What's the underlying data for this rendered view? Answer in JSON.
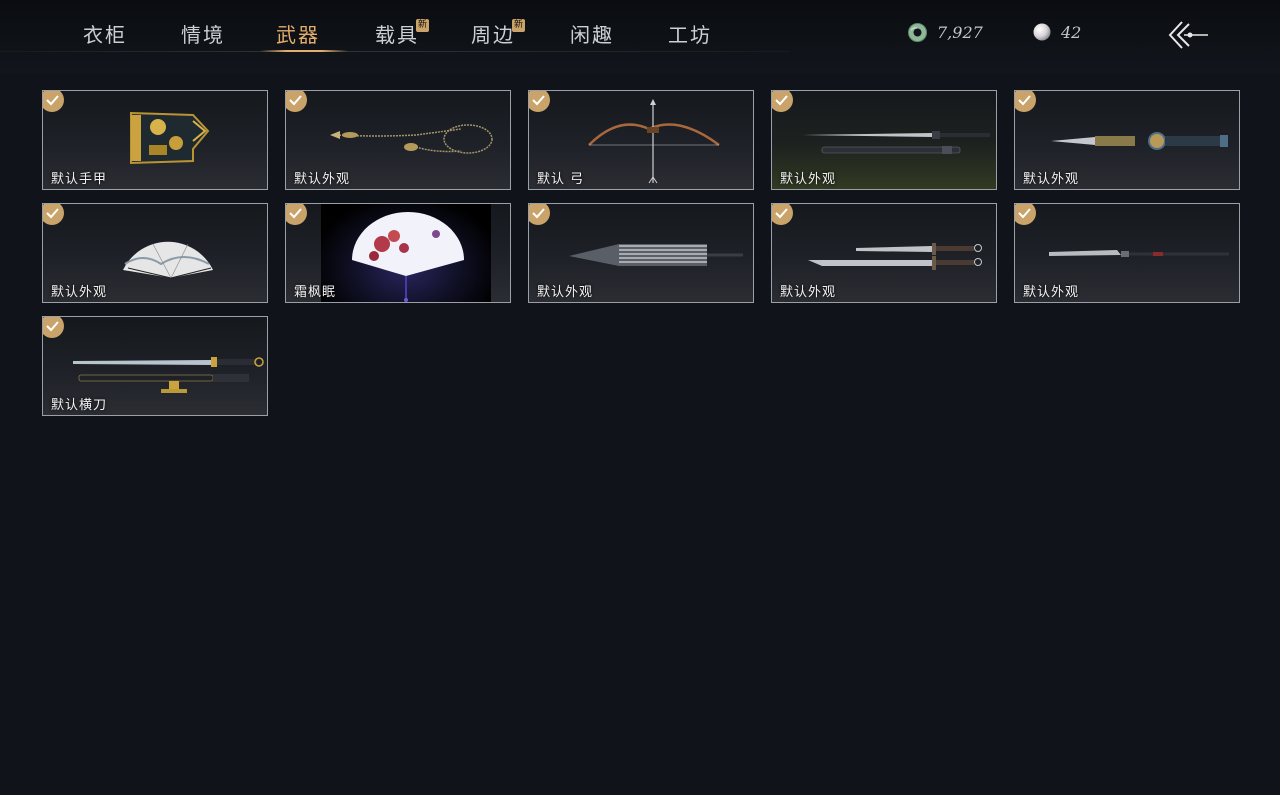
{
  "nav": {
    "tabs": [
      {
        "label": "衣柜",
        "active": false,
        "badge": ""
      },
      {
        "label": "情境",
        "active": false,
        "badge": ""
      },
      {
        "label": "武器",
        "active": true,
        "badge": ""
      },
      {
        "label": "载具",
        "active": false,
        "badge": "新"
      },
      {
        "label": "周边",
        "active": false,
        "badge": "新"
      },
      {
        "label": "闲趣",
        "active": false,
        "badge": ""
      },
      {
        "label": "工坊",
        "active": false,
        "badge": ""
      }
    ]
  },
  "currency": {
    "jade": {
      "value": "7,927",
      "icon": "jade-coin-icon"
    },
    "pearl": {
      "value": "42",
      "icon": "pearl-icon"
    }
  },
  "back": {
    "icon": "back-arrow-icon"
  },
  "colors": {
    "accent": "#e3ad6c",
    "check": "#c9a36a",
    "background": "#10141a"
  },
  "items": [
    {
      "label": "默认手甲",
      "art": "gauntlet",
      "equipped": true
    },
    {
      "label": "默认外观",
      "art": "rope-dart",
      "equipped": true
    },
    {
      "label": "默认 弓",
      "art": "bow",
      "equipped": true
    },
    {
      "label": "默认外观",
      "art": "double-sword",
      "equipped": true
    },
    {
      "label": "默认外观",
      "art": "blade-staff",
      "equipped": true
    },
    {
      "label": "默认外观",
      "art": "fan",
      "equipped": true
    },
    {
      "label": "霜枫眠",
      "art": "maple-fan",
      "equipped": true
    },
    {
      "label": "默认外观",
      "art": "umbrella",
      "equipped": true
    },
    {
      "label": "默认外观",
      "art": "twin-blades",
      "equipped": true
    },
    {
      "label": "默认外观",
      "art": "spear",
      "equipped": true
    },
    {
      "label": "默认横刀",
      "art": "hengdao",
      "equipped": true
    }
  ]
}
